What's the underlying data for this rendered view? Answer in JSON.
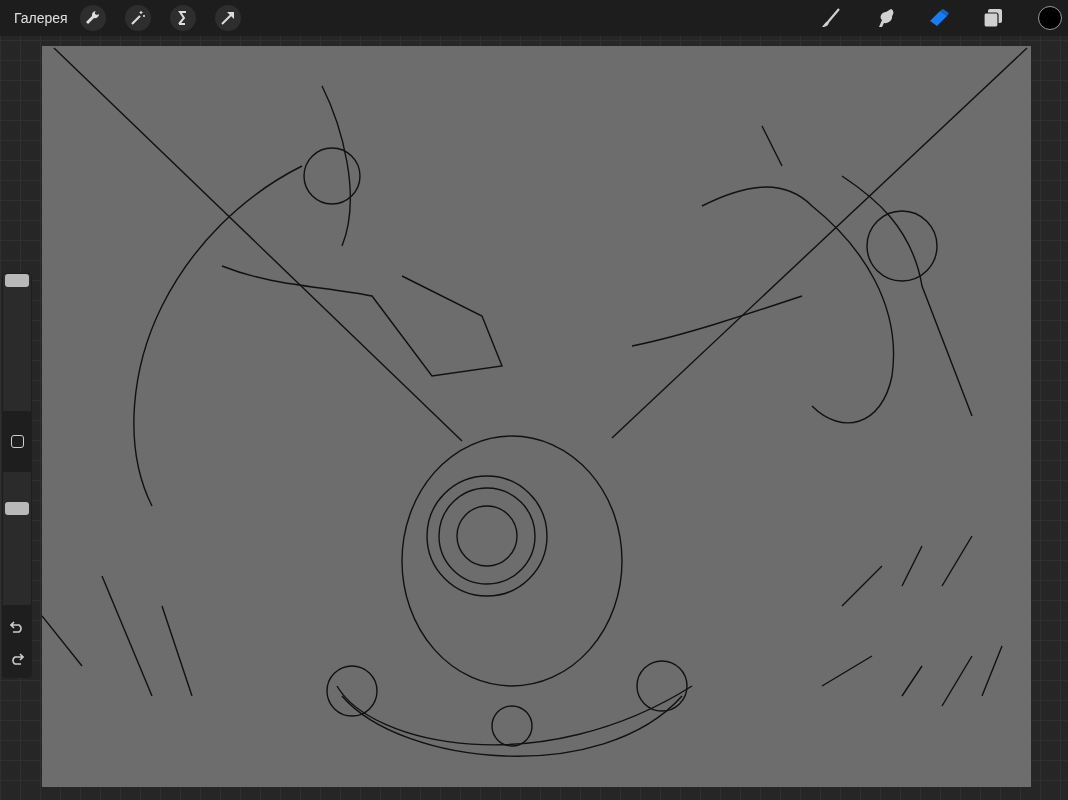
{
  "top_bar": {
    "gallery_label": "Галерея",
    "actions": [
      {
        "kind": "wrench"
      },
      {
        "kind": "wand"
      },
      {
        "kind": "selection"
      },
      {
        "kind": "transform"
      }
    ],
    "tools": [
      {
        "kind": "brush",
        "selected": false
      },
      {
        "kind": "smudge",
        "selected": false
      },
      {
        "kind": "eraser",
        "selected": true
      },
      {
        "kind": "layers",
        "selected": false
      }
    ],
    "color": "#000000"
  },
  "sidebar": {
    "size_slider": {
      "level": 1.0
    },
    "opacity_slider": {
      "level": 0.75
    }
  }
}
